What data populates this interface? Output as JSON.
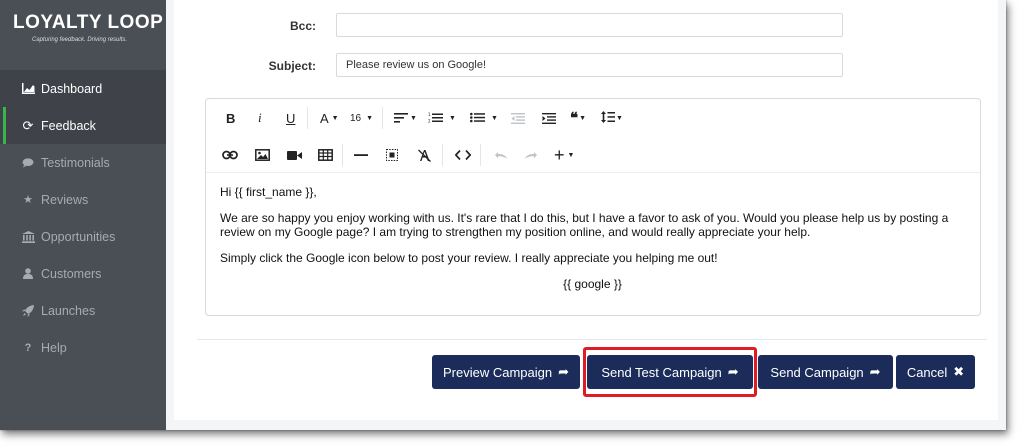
{
  "brand": {
    "name": "LOYALTY LOOP",
    "tagline": "Capturing feedback. Driving results."
  },
  "sidebar": {
    "items": [
      {
        "label": "Dashboard",
        "icon": "chart-icon"
      },
      {
        "label": "Feedback",
        "icon": "refresh-icon"
      },
      {
        "label": "Testimonials",
        "icon": "comment-icon"
      },
      {
        "label": "Reviews",
        "icon": "star-icon"
      },
      {
        "label": "Opportunities",
        "icon": "bank-icon"
      },
      {
        "label": "Customers",
        "icon": "user-icon"
      },
      {
        "label": "Launches",
        "icon": "rocket-icon"
      },
      {
        "label": "Help",
        "icon": "question-icon"
      }
    ]
  },
  "form": {
    "bcc_label": "Bcc:",
    "bcc_value": "",
    "subject_label": "Subject:",
    "subject_value": "Please review us on Google!"
  },
  "toolbar": {
    "bold": "B",
    "italic": "i",
    "underline": "U",
    "font_color": "A",
    "font_size": "16",
    "quote": "❝",
    "more": "+"
  },
  "body": {
    "greeting": "Hi {{ first_name }},",
    "paragraph1": "We are so happy you enjoy working with us. It's rare that I do this, but I have a favor to ask of you. Would you please help us by posting a review on my Google page? I am trying to strengthen my position online, and would really appreciate your help.",
    "paragraph2": "Simply click the Google icon below to post your review. I really appreciate you helping me out!",
    "token": "{{ google }}"
  },
  "actions": {
    "preview": "Preview Campaign",
    "send_test": "Send Test Campaign",
    "send": "Send Campaign",
    "cancel": "Cancel"
  },
  "colors": {
    "sidebar_bg": "#4a4e55",
    "button_bg": "#1b2b5a",
    "accent_green": "#3ab54a",
    "highlight_red": "#e01b22"
  }
}
